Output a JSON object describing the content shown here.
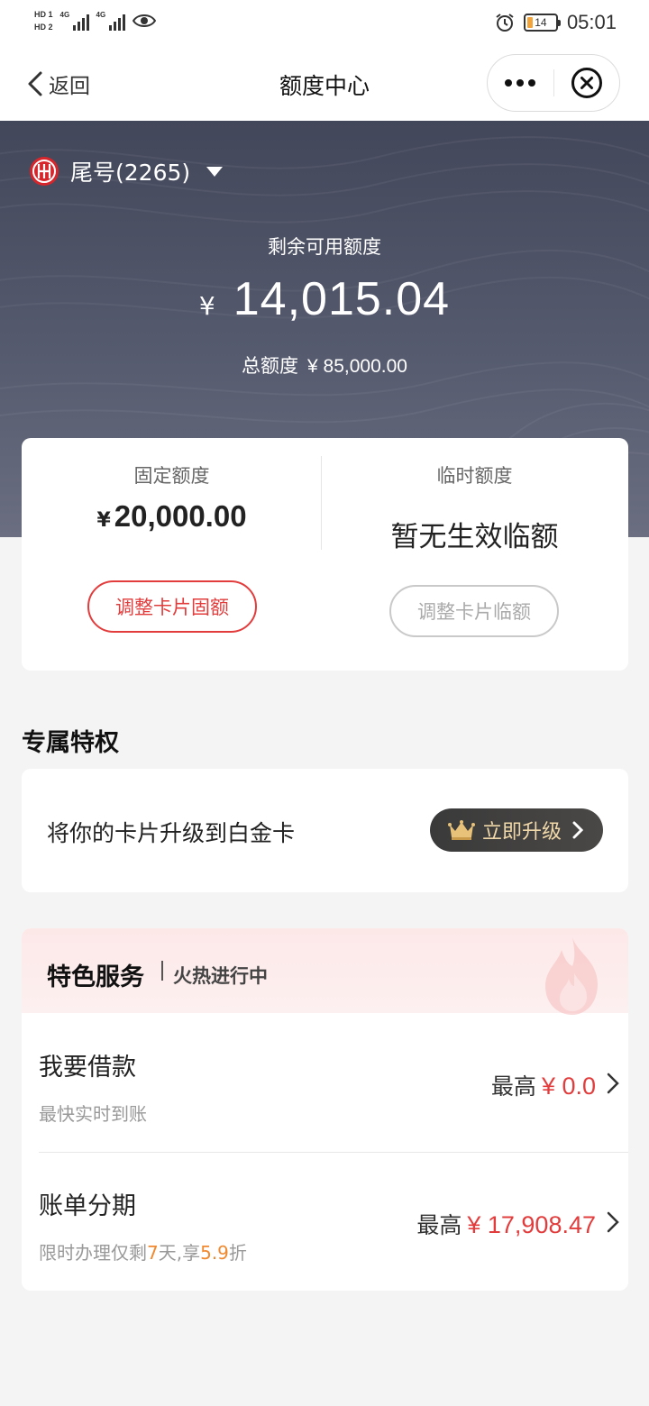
{
  "status_bar": {
    "sim1": "HD 1",
    "sim2": "HD 2",
    "network1": "4G",
    "network2": "4G",
    "battery_percent": "14",
    "time": "05:01"
  },
  "nav": {
    "back_label": "返回",
    "title": "额度中心"
  },
  "hero": {
    "card_tail": "尾号(2265)",
    "available_label": "剩余可用额度",
    "currency": "¥",
    "available_amount": "14,015.04",
    "total_label": "总额度",
    "total_amount": "¥ 85,000.00"
  },
  "limits": {
    "fixed_label": "固定额度",
    "fixed_currency": "¥",
    "fixed_amount": "20,000.00",
    "fixed_button": "调整卡片固额",
    "temp_label": "临时额度",
    "temp_value": "暂无生效临额",
    "temp_button": "调整卡片临额"
  },
  "privileges": {
    "section_title": "专属特权",
    "upgrade_text": "将你的卡片升级到白金卡",
    "upgrade_button": "立即升级"
  },
  "services": {
    "title": "特色服务",
    "subtitle": "火热进行中",
    "items": [
      {
        "name": "我要借款",
        "desc": "最快实时到账",
        "max_label": "最高",
        "max_value": "¥ 0.0"
      },
      {
        "name": "账单分期",
        "desc_prefix": "限时办理仅剩",
        "desc_days": "7",
        "desc_mid": "天,享",
        "desc_discount": "5.9",
        "desc_suffix": "折",
        "max_label": "最高",
        "max_value": "¥ 17,908.47"
      }
    ]
  },
  "colors": {
    "accent_red": "#e23c3c",
    "highlight_orange": "#f0892f",
    "hero_bg": "#4a4e60",
    "gold": "#f1d8a8"
  }
}
